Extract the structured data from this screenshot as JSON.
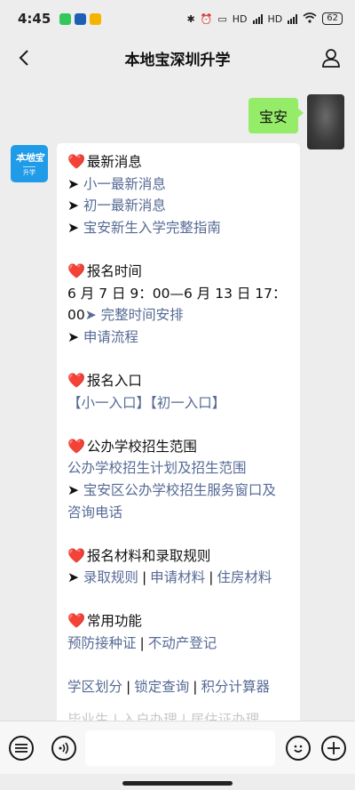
{
  "status": {
    "time": "4:45",
    "net1": "HD",
    "net2": "HD",
    "battery": "62",
    "apps": [
      "#34c759",
      "#1e5fb4",
      "#f4b400"
    ]
  },
  "header": {
    "title": "本地宝深圳升学"
  },
  "chat": {
    "my_message": "宝安",
    "bot_avatar": {
      "line1": "本地宝",
      "line2": "升学"
    },
    "sections": {
      "latest": {
        "heading": "最新消息",
        "items": [
          "小一最新消息",
          "初一最新消息",
          "宝安新生入学完整指南"
        ]
      },
      "time": {
        "heading": "报名时间",
        "line1": "6 月 7 日 9：00—6 月 13 日 17：",
        "line2_prefix": "00",
        "link": "完整时间安排",
        "process": "申请流程"
      },
      "entry": {
        "heading": "报名入口",
        "primary": "【小一入口】",
        "secondary": "【初一入口】"
      },
      "scope": {
        "heading": "公办学校招生范围",
        "plan": "公办学校招生计划及招生范围",
        "window_line1": "宝安区公办学校招生服务窗口及",
        "window_line2": "咨询电话"
      },
      "materials": {
        "heading": "报名材料和录取规则",
        "items": [
          "录取规则",
          "申请材料",
          "住房材料"
        ]
      },
      "common": {
        "heading": "常用功能",
        "row1": [
          "预防接种证",
          "不动产登记"
        ],
        "row2": [
          "学区划分",
          "锁定查询",
          "积分计算器"
        ],
        "row3": "毕业生 | 入户办理 | 居住证办理"
      }
    }
  },
  "colors": {
    "link": "#576b95",
    "my_bubble": "#95ec69",
    "heart": "#e0242c",
    "bot_avatar_bg": "#1f9be8"
  },
  "icons": [
    "back-icon",
    "user-icon",
    "menu-list-icon",
    "voice-icon",
    "emoji-icon",
    "plus-icon"
  ]
}
